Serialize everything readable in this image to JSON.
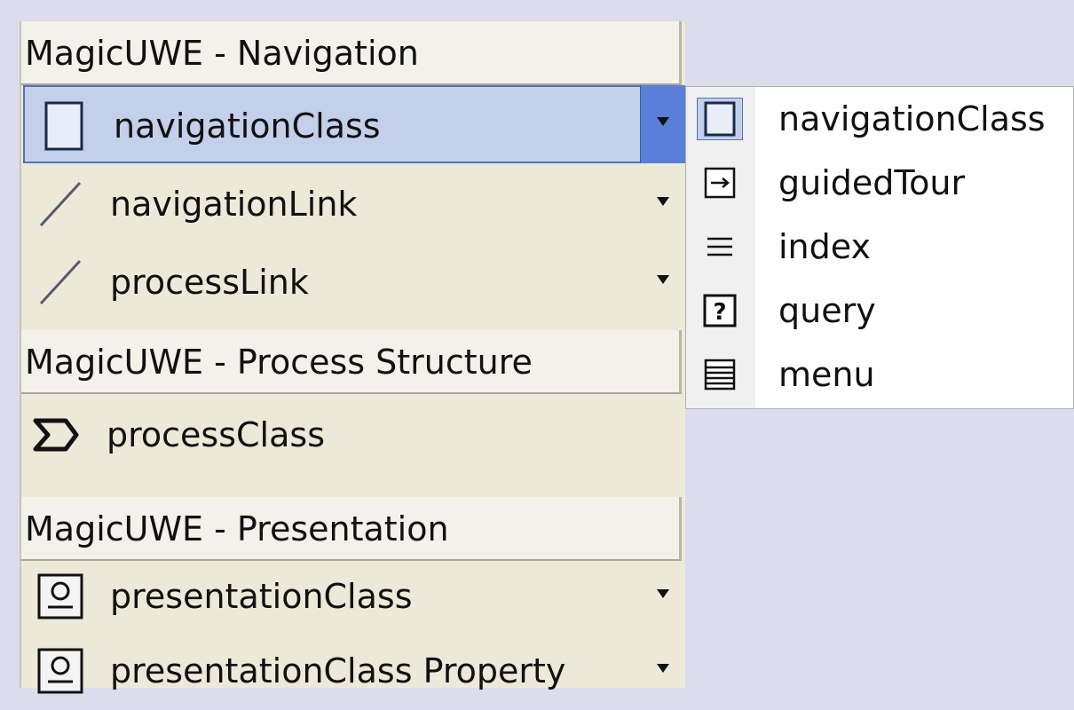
{
  "palette": {
    "sections": [
      {
        "header": "MagicUWE - Navigation",
        "tools": [
          {
            "label": "navigationClass",
            "icon": "class-box-icon",
            "has_dropdown": true,
            "selected": true
          },
          {
            "label": "navigationLink",
            "icon": "link-line-icon",
            "has_dropdown": true,
            "selected": false
          },
          {
            "label": "processLink",
            "icon": "link-line-icon",
            "has_dropdown": true,
            "selected": false
          }
        ]
      },
      {
        "header": "MagicUWE - Process Structure",
        "tools": [
          {
            "label": "processClass",
            "icon": "sigma-icon",
            "has_dropdown": false,
            "selected": false
          }
        ]
      },
      {
        "header": "MagicUWE - Presentation",
        "tools": [
          {
            "label": "presentationClass",
            "icon": "presentation-icon",
            "has_dropdown": true,
            "selected": false
          },
          {
            "label": "presentationClass Property",
            "icon": "presentation-icon",
            "has_dropdown": true,
            "selected": false
          }
        ]
      }
    ]
  },
  "dropdown_menu": {
    "items": [
      {
        "label": "navigationClass",
        "icon": "class-box-icon"
      },
      {
        "label": "guidedTour",
        "icon": "arrow-box-icon"
      },
      {
        "label": "index",
        "icon": "lines-icon"
      },
      {
        "label": "query",
        "icon": "question-box-icon"
      },
      {
        "label": "menu",
        "icon": "menu-list-icon"
      }
    ]
  },
  "colors": {
    "background": "#dcdcec",
    "palette_bg": "#ece9d8",
    "selection": "#c3d0ea",
    "selection_border": "#5472b8",
    "dropdown_button": "#5a7fd8"
  }
}
